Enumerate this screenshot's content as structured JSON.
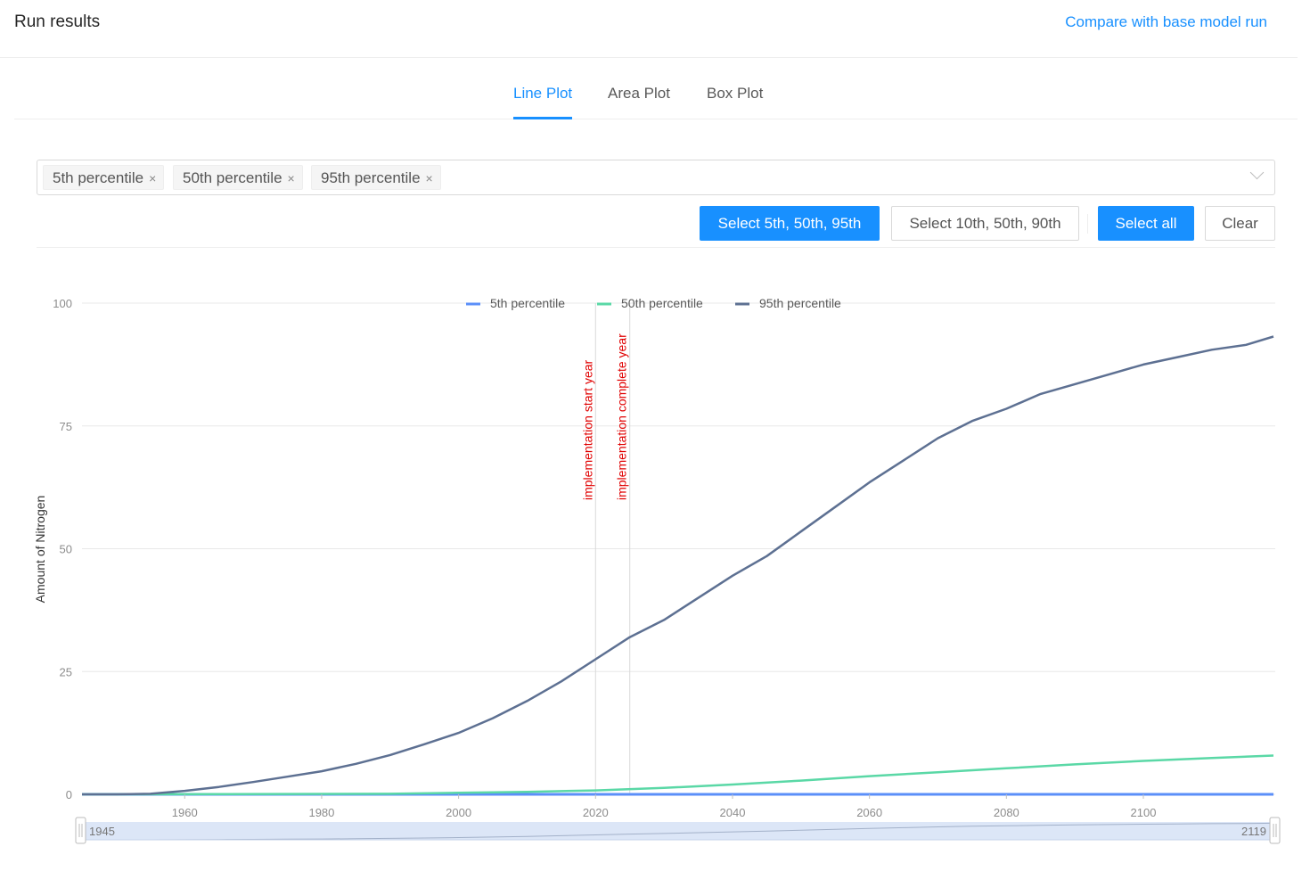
{
  "header": {
    "title": "Run results",
    "compare_link": "Compare with base model run"
  },
  "tabs": [
    {
      "label": "Line Plot",
      "active": true
    },
    {
      "label": "Area Plot",
      "active": false
    },
    {
      "label": "Box Plot",
      "active": false
    }
  ],
  "selector": {
    "tags": [
      "5th percentile",
      "50th percentile",
      "95th percentile"
    ],
    "remove_icon": "×",
    "dropdown_icon": "chevron-down-icon"
  },
  "buttons": {
    "select_5_50_95": "Select 5th, 50th, 95th",
    "select_10_50_90": "Select 10th, 50th, 90th",
    "select_all": "Select all",
    "clear": "Clear"
  },
  "colors": {
    "accent": "#1890ff",
    "p5": "#5b8ff9",
    "p50": "#5ad8a6",
    "p95": "#5d7092",
    "annotation": "#e00000"
  },
  "chart_data": {
    "type": "line",
    "title": "",
    "xlabel": "",
    "ylabel": "Amount of Nitrogen",
    "xlim": [
      1945,
      2119
    ],
    "ylim": [
      0,
      100
    ],
    "x_ticks": [
      1960,
      1980,
      2000,
      2020,
      2040,
      2060,
      2080,
      2100
    ],
    "y_ticks": [
      0,
      25,
      50,
      75,
      100
    ],
    "grid": true,
    "legend": "top-center",
    "annotations": [
      {
        "x": 2020,
        "label": "implementation start year"
      },
      {
        "x": 2025,
        "label": "implementation complete year"
      }
    ],
    "slider": {
      "start": "1945",
      "end": "2119"
    },
    "series": [
      {
        "name": "5th percentile",
        "x": [
          1945,
          2000,
          2050,
          2119
        ],
        "values": [
          0,
          0,
          0,
          0
        ]
      },
      {
        "name": "50th percentile",
        "x": [
          1945,
          1990,
          2000,
          2010,
          2020,
          2030,
          2040,
          2050,
          2060,
          2070,
          2080,
          2090,
          2100,
          2110,
          2119
        ],
        "values": [
          0,
          0.1,
          0.3,
          0.5,
          0.8,
          1.3,
          2.0,
          2.8,
          3.7,
          4.5,
          5.3,
          6.1,
          6.8,
          7.4,
          7.9
        ]
      },
      {
        "name": "95th percentile",
        "x": [
          1945,
          1950,
          1955,
          1960,
          1965,
          1970,
          1975,
          1980,
          1985,
          1990,
          1995,
          2000,
          2005,
          2010,
          2015,
          2020,
          2025,
          2030,
          2035,
          2040,
          2045,
          2050,
          2055,
          2060,
          2065,
          2070,
          2075,
          2080,
          2085,
          2090,
          2095,
          2100,
          2105,
          2110,
          2115,
          2119
        ],
        "values": [
          0,
          0,
          0.1,
          0.7,
          1.5,
          2.5,
          3.6,
          4.7,
          6.2,
          8.0,
          10.2,
          12.5,
          15.5,
          19.0,
          23.0,
          27.5,
          32.0,
          35.5,
          40.0,
          44.5,
          48.5,
          53.5,
          58.5,
          63.5,
          68.0,
          72.5,
          76.0,
          78.5,
          81.5,
          83.5,
          85.5,
          87.5,
          89.0,
          90.5,
          91.5,
          93.2
        ]
      }
    ]
  }
}
